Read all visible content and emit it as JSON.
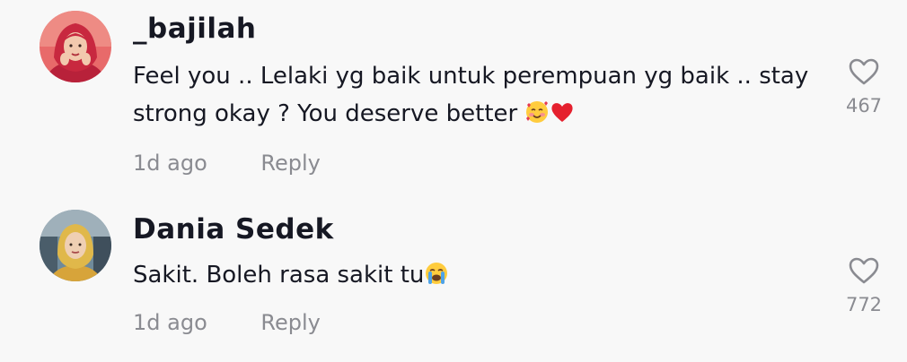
{
  "comments": [
    {
      "username": "_bajilah",
      "text": "Feel you .. Lelaki yg baik untuk perempuan yg baik .. stay strong okay ? You deserve better",
      "emojis": [
        "smiling-face-with-hearts",
        "red-heart"
      ],
      "time": "1d ago",
      "reply_label": "Reply",
      "likes": "467",
      "avatar_icon": "avatar-photo-red-hijab"
    },
    {
      "username": "Dania Sedek",
      "text": "Sakit. Boleh rasa sakit tu",
      "emojis": [
        "loudly-crying-face"
      ],
      "time": "1d ago",
      "reply_label": "Reply",
      "likes": "772",
      "avatar_icon": "avatar-photo-yellow-hijab"
    }
  ],
  "colors": {
    "background": "#f8f8f8",
    "primary_text": "#161823",
    "secondary_text": "#8a8b91"
  }
}
